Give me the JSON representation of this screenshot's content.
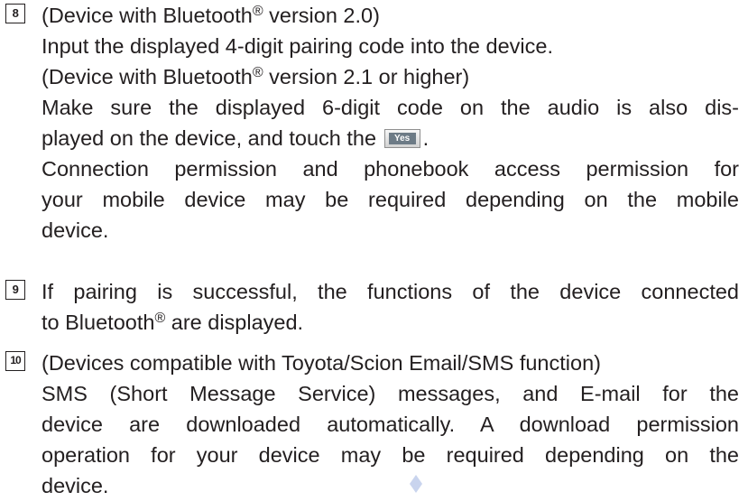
{
  "steps": [
    {
      "number": "8",
      "lines": {
        "l1_pre": "(Device with Bluetooth",
        "l1_sup": "®",
        "l1_post": " version 2.0)",
        "l2": "Input the displayed 4-digit pairing code into the device.",
        "l3_pre": "(Device with Bluetooth",
        "l3_sup": "®",
        "l3_post": " version 2.1 or higher)",
        "l4": "Make sure the displayed 6-digit code on the audio is also dis-",
        "l5_pre": "played on the device, and touch the",
        "l5_button": "Yes",
        "l5_post": ".",
        "l6": "Connection permission and phonebook access permission for",
        "l7": "your mobile device may be required depending on the mobile",
        "l8": "device."
      }
    },
    {
      "number": "9",
      "lines": {
        "l1": "If pairing is successful, the functions of the device connected",
        "l2_pre": "to Bluetooth",
        "l2_sup": "®",
        "l2_post": " are displayed."
      }
    },
    {
      "number": "10",
      "lines": {
        "l1": "(Devices compatible with Toyota/Scion Email/SMS function)",
        "l2": "SMS (Short Message Service) messages, and E-mail for the",
        "l3": "device are downloaded automatically. A download permission",
        "l4": "operation for your device may be required depending on the",
        "l5": "device."
      }
    }
  ],
  "colors": {
    "text": "#231f20",
    "marker": "#c9d4ee"
  }
}
